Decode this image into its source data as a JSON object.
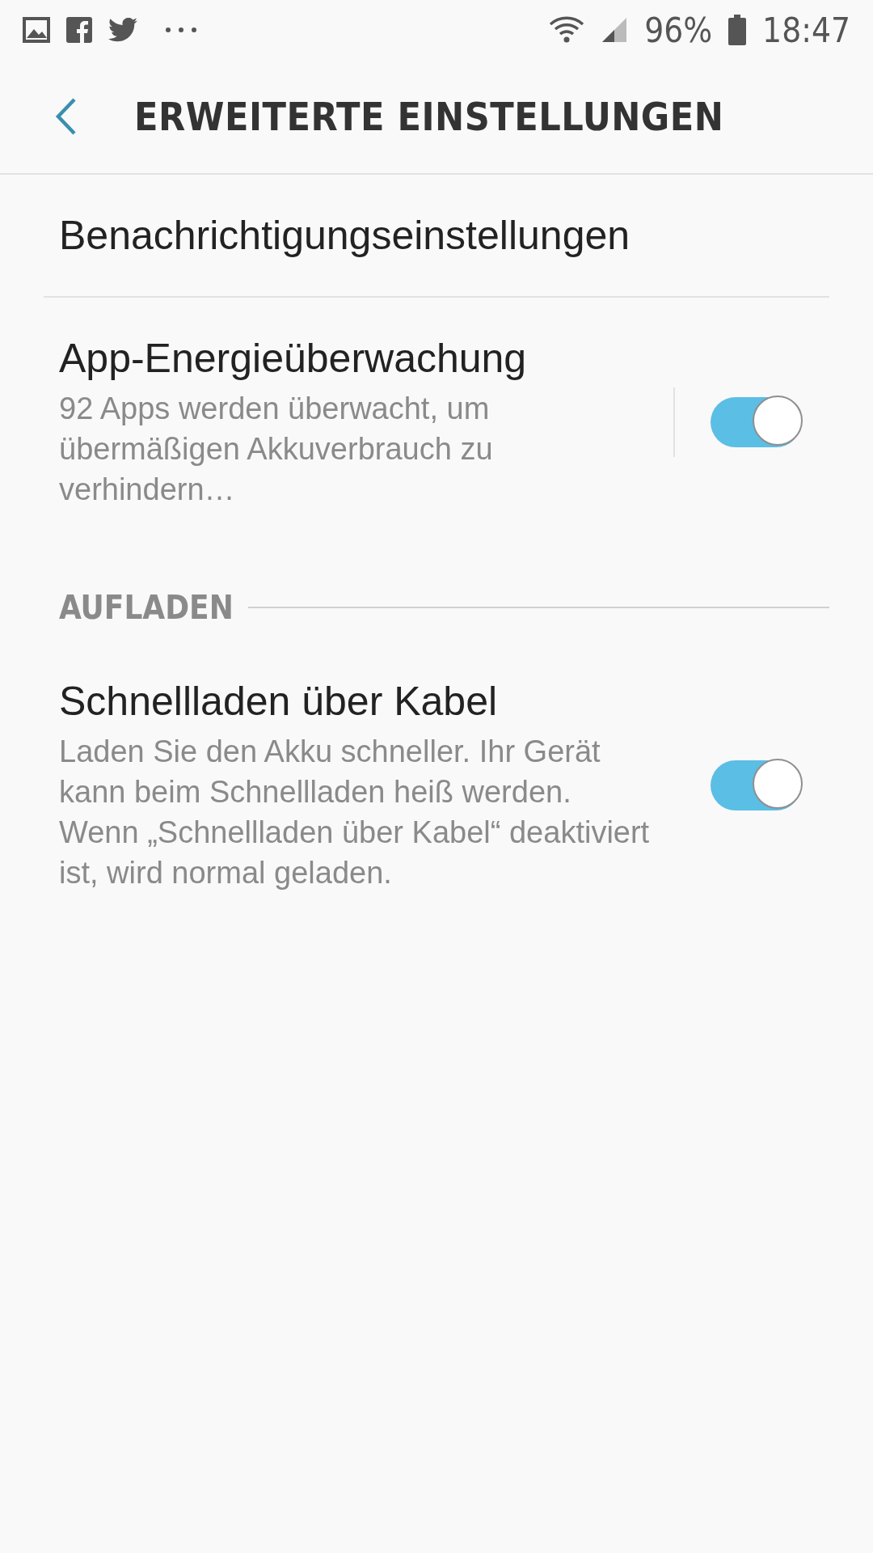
{
  "status_bar": {
    "battery": "96%",
    "time": "18:47"
  },
  "header": {
    "title": "ERWEITERTE EINSTELLUNGEN"
  },
  "items": [
    {
      "kind": "link",
      "title": "Benachrichtigungseinstellungen"
    },
    {
      "kind": "switch",
      "title": "App-Energieüberwachung",
      "subtitle": "92 Apps werden überwacht, um übermäßigen Akkuverbrauch zu verhindern…",
      "on": true,
      "separator": true
    },
    {
      "kind": "section",
      "title": "AUFLADEN"
    },
    {
      "kind": "switch",
      "title": "Schnellladen über Kabel",
      "subtitle": "Laden Sie den Akku schneller. Ihr Gerät kann beim Schnellladen heiß werden. Wenn „Schnellladen über Kabel“ deaktiviert ist, wird normal geladen.",
      "on": true,
      "separator": false
    }
  ]
}
